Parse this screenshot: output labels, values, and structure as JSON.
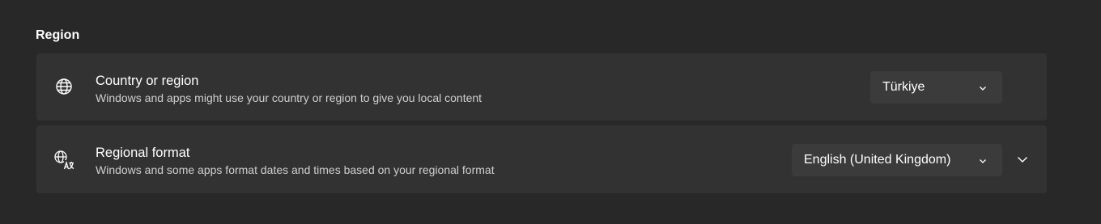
{
  "section": {
    "title": "Region"
  },
  "country_region": {
    "icon": "globe-icon",
    "title": "Country or region",
    "description": "Windows and apps might use your country or region to give you local content",
    "selected_value": "Türkiye"
  },
  "regional_format": {
    "icon": "language-format-icon",
    "title": "Regional format",
    "description": "Windows and some apps format dates and times based on your regional format",
    "selected_value": "English (United Kingdom)",
    "expand_icon": "chevron-down-icon"
  },
  "colors": {
    "background": "#282828",
    "card": "#323232",
    "dropdown": "#3b3b3b",
    "text_primary": "#ffffff",
    "text_secondary": "#cfcfcf"
  }
}
